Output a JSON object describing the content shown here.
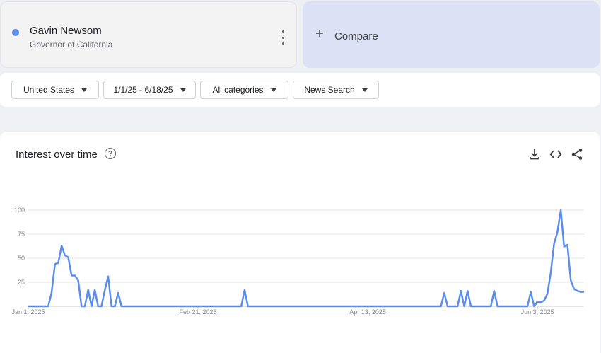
{
  "term": {
    "name": "Gavin Newsom",
    "subtitle": "Governor of California",
    "color": "#5b8def"
  },
  "compare": {
    "label": "Compare",
    "plus": "+"
  },
  "filters": [
    {
      "label": "United States"
    },
    {
      "label": "1/1/25 - 6/18/25"
    },
    {
      "label": "All categories"
    },
    {
      "label": "News Search"
    }
  ],
  "panel": {
    "title": "Interest over time",
    "help": "?"
  },
  "icons": [
    "more-vert-icon",
    "add-icon",
    "caret-down-icon",
    "help-icon",
    "download-icon",
    "embed-code-icon",
    "share-icon"
  ],
  "chart_data": {
    "type": "line",
    "title": "Interest over time",
    "ylim": [
      0,
      100
    ],
    "yticks": [
      25,
      50,
      75,
      100
    ],
    "x_tick_labels": [
      "Jan 1, 2025",
      "Feb 21, 2025",
      "Apr 13, 2025",
      "Jun 3, 2025"
    ],
    "x_tick_days": [
      0,
      51,
      102,
      153
    ],
    "total_days": 168,
    "grid": true,
    "series": [
      {
        "color": "#5b8def",
        "points": [
          [
            0,
            0
          ],
          [
            6,
            0
          ],
          [
            7,
            14
          ],
          [
            8,
            44
          ],
          [
            9,
            45
          ],
          [
            10,
            63
          ],
          [
            11,
            53
          ],
          [
            12,
            51
          ],
          [
            13,
            32
          ],
          [
            14,
            32
          ],
          [
            15,
            27
          ],
          [
            16,
            0
          ],
          [
            17,
            0
          ],
          [
            18,
            17
          ],
          [
            19,
            0
          ],
          [
            20,
            17
          ],
          [
            21,
            0
          ],
          [
            22,
            0
          ],
          [
            23,
            17
          ],
          [
            24,
            31
          ],
          [
            25,
            0
          ],
          [
            26,
            0
          ],
          [
            27,
            14
          ],
          [
            28,
            0
          ],
          [
            64,
            0
          ],
          [
            65,
            17
          ],
          [
            66,
            0
          ],
          [
            124,
            0
          ],
          [
            125,
            14
          ],
          [
            126,
            0
          ],
          [
            129,
            0
          ],
          [
            130,
            16
          ],
          [
            131,
            0
          ],
          [
            132,
            16
          ],
          [
            133,
            0
          ],
          [
            139,
            0
          ],
          [
            140,
            16
          ],
          [
            141,
            0
          ],
          [
            150,
            0
          ],
          [
            151,
            15
          ],
          [
            152,
            0
          ],
          [
            153,
            5
          ],
          [
            154,
            4
          ],
          [
            155,
            6
          ],
          [
            156,
            13
          ],
          [
            157,
            35
          ],
          [
            158,
            65
          ],
          [
            159,
            77
          ],
          [
            160,
            100
          ],
          [
            161,
            62
          ],
          [
            162,
            64
          ],
          [
            163,
            27
          ],
          [
            164,
            18
          ],
          [
            165,
            16
          ],
          [
            166,
            15
          ],
          [
            167,
            15
          ]
        ]
      }
    ]
  }
}
